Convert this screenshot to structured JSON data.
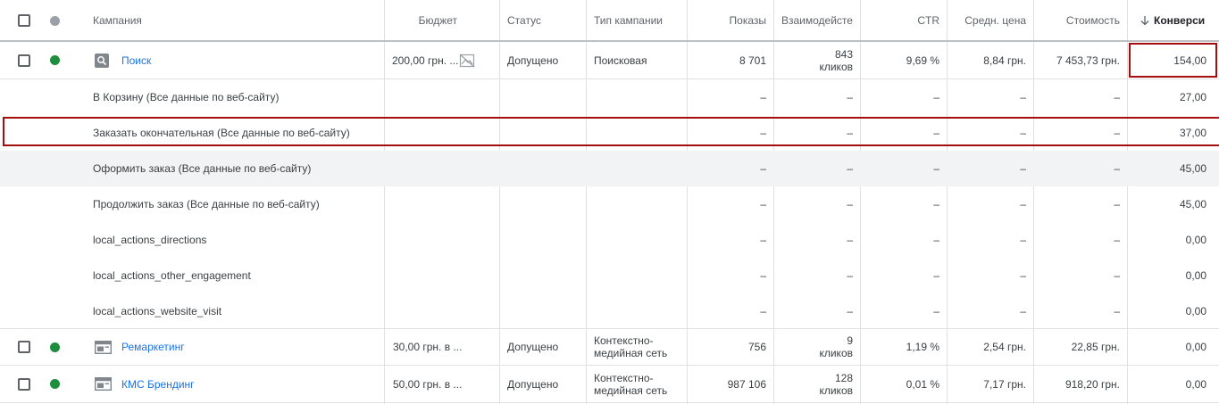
{
  "header": {
    "campaign": "Кампания",
    "budget": "Бюджет",
    "status": "Статус",
    "type": "Тип кампании",
    "impressions": "Показы",
    "interactions": "Взаимодейсте",
    "ctr": "CTR",
    "avg_cost": "Средн. цена",
    "cost": "Стоимость",
    "conversions": "Конверси",
    "sort_icon": "arrow-down-icon"
  },
  "colors": {
    "enabled_dot": "#1e8e3e",
    "header_dot": "#9aa0a6",
    "link": "#1a73e8",
    "highlight_border": "#a50e0e",
    "shaded_row": "#f1f3f4"
  },
  "campaigns": [
    {
      "name": "Поиск",
      "icon": "search-campaign-icon",
      "budget": "200,00 грн. ...",
      "budget_icon": "no-image-icon",
      "status": "Допущено",
      "type": "Поисковая",
      "impressions": "8 701",
      "interactions_value": "843",
      "interactions_unit": "кликов",
      "ctr": "9,69 %",
      "avg_cost": "8,84 грн.",
      "cost": "7 453,73 грн.",
      "conversions": "154,00"
    },
    {
      "name": "Ремаркетинг",
      "icon": "display-campaign-icon",
      "budget": "30,00 грн. в ...",
      "status": "Допущено",
      "type_line1": "Контекстно-",
      "type_line2": "медийная сеть",
      "impressions": "756",
      "interactions_value": "9",
      "interactions_unit": "кликов",
      "ctr": "1,19 %",
      "avg_cost": "2,54 грн.",
      "cost": "22,85 грн.",
      "conversions": "0,00"
    },
    {
      "name": "КМС Брендинг",
      "icon": "display-campaign-icon",
      "budget": "50,00 грн. в ...",
      "status": "Допущено",
      "type_line1": "Контекстно-",
      "type_line2": "медийная сеть",
      "impressions": "987 106",
      "interactions_value": "128",
      "interactions_unit": "кликов",
      "ctr": "0,01 %",
      "avg_cost": "7,17 грн.",
      "cost": "918,20 грн.",
      "conversions": "0,00"
    }
  ],
  "subrows": [
    {
      "name": "В Корзину (Все данные по веб-сайту)",
      "dash": "–",
      "conversions": "27,00"
    },
    {
      "name": "Заказать окончательная (Все данные по веб-сайту)",
      "dash": "–",
      "conversions": "37,00"
    },
    {
      "name": "Оформить заказ (Все данные по веб-сайту)",
      "dash": "–",
      "conversions": "45,00"
    },
    {
      "name": "Продолжить заказ (Все данные по веб-сайту)",
      "dash": "–",
      "conversions": "45,00"
    },
    {
      "name": "local_actions_directions",
      "dash": "–",
      "conversions": "0,00"
    },
    {
      "name": "local_actions_other_engagement",
      "dash": "–",
      "conversions": "0,00"
    },
    {
      "name": "local_actions_website_visit",
      "dash": "–",
      "conversions": "0,00"
    }
  ]
}
